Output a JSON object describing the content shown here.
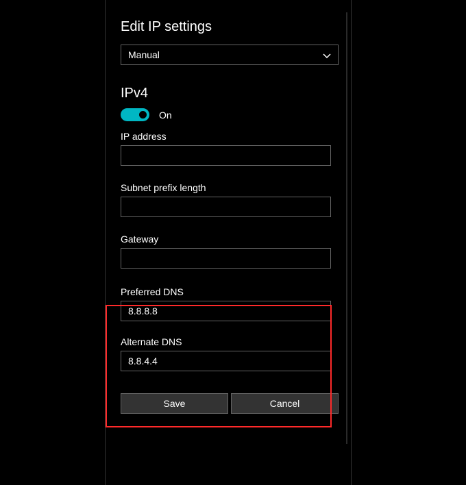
{
  "title": "Edit IP settings",
  "mode_select": {
    "value": "Manual"
  },
  "ipv4": {
    "heading": "IPv4",
    "toggle_state": "On"
  },
  "fields": {
    "ip_address": {
      "label": "IP address",
      "value": ""
    },
    "subnet_prefix": {
      "label": "Subnet prefix length",
      "value": ""
    },
    "gateway": {
      "label": "Gateway",
      "value": ""
    },
    "preferred_dns": {
      "label": "Preferred DNS",
      "value": "8.8.8.8"
    },
    "alternate_dns": {
      "label": "Alternate DNS",
      "value": "8.8.4.4"
    }
  },
  "buttons": {
    "save": "Save",
    "cancel": "Cancel"
  }
}
